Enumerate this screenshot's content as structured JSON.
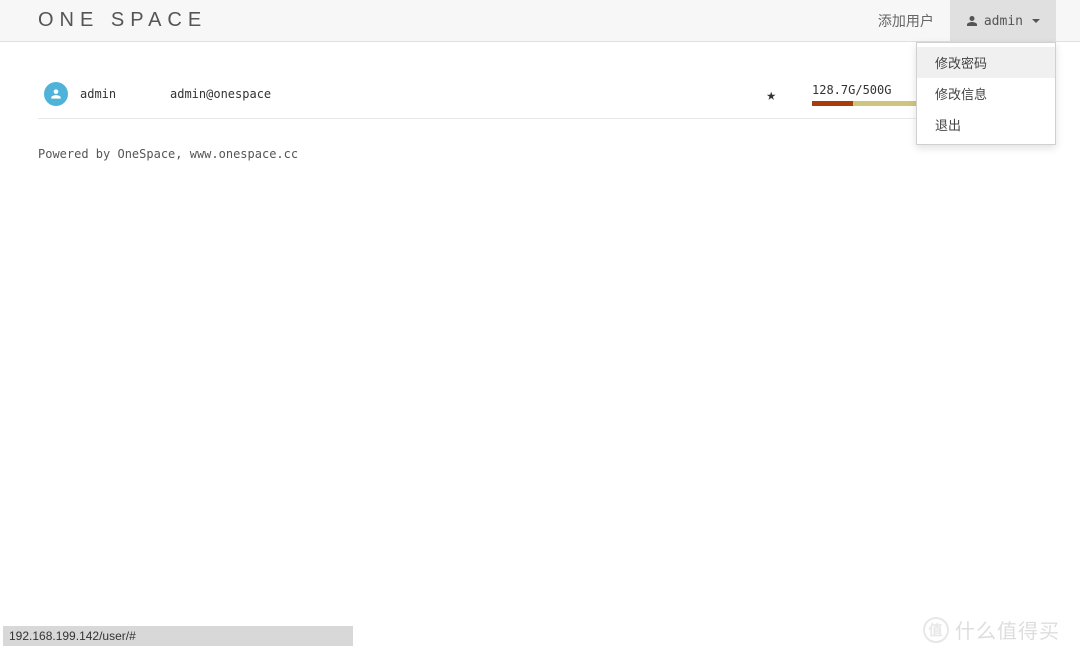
{
  "header": {
    "logo": "ONE SPACE",
    "add_user_label": "添加用户",
    "current_user": "admin"
  },
  "dropdown": {
    "items": [
      {
        "label": "修改密码",
        "active": true
      },
      {
        "label": "修改信息",
        "active": false
      },
      {
        "label": "退出",
        "active": false
      }
    ]
  },
  "users": [
    {
      "username": "admin",
      "email": "admin@onespace",
      "starred": true,
      "storage_text": "128.7G/500G",
      "storage_percent": 25.7
    }
  ],
  "footer": "Powered by OneSpace, www.onespace.cc",
  "status_bar": "192.168.199.142/user/#",
  "watermark": "什么值得买",
  "colors": {
    "progress_bg": "#cec67e",
    "progress_fill": "#a83c0d",
    "avatar_bg": "#4fb3d9"
  }
}
